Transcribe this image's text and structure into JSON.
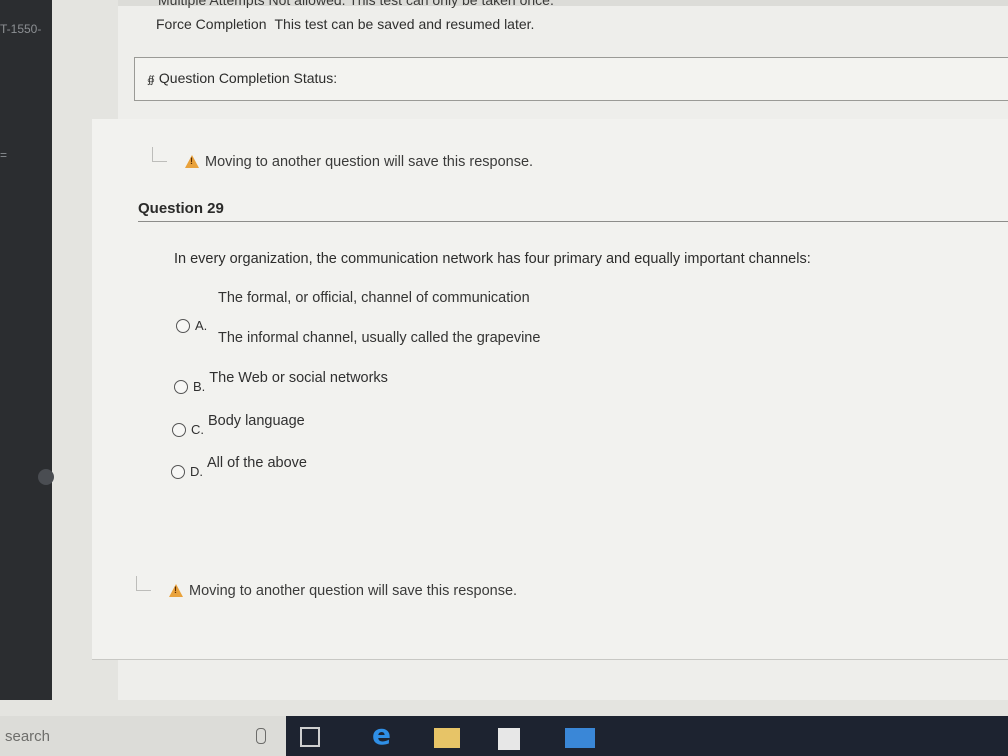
{
  "sidebar": {
    "course_code": "T-1550-",
    "mark": "="
  },
  "test_info": {
    "multiple_attempts_line": "Multiple Attempts  Not allowed. This test can only be taken once.",
    "force_completion_label": "Force Completion",
    "force_completion_text": "This test can be saved and resumed later."
  },
  "status": {
    "label": "Question Completion Status:",
    "chevron_icon": "double-chevron-down-icon"
  },
  "save_notice": {
    "text": "Moving to another question will save this response.",
    "icon": "warning-icon"
  },
  "question": {
    "title": "Question 29",
    "prompt": "In every organization, the communication network has four primary and equally important channels:",
    "channels": [
      "The formal, or official, channel of communication",
      "The informal channel, usually called the grapevine"
    ],
    "options": [
      {
        "letter": "A.",
        "text": ""
      },
      {
        "letter": "B.",
        "text": "The Web or social networks"
      },
      {
        "letter": "C.",
        "text": "Body language"
      },
      {
        "letter": "D.",
        "text": "All of the above"
      }
    ]
  },
  "taskbar": {
    "search_placeholder": "search",
    "icons": [
      "microphone-icon",
      "task-view-icon",
      "edge-browser-icon",
      "file-explorer-icon",
      "store-icon",
      "mail-icon"
    ]
  }
}
